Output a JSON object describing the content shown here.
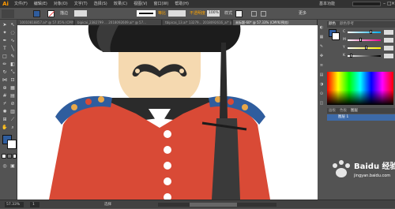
{
  "app": {
    "logo": "Ai"
  },
  "menu": [
    "文件(F)",
    "编辑(E)",
    "对象(O)",
    "文字(T)",
    "选择(S)",
    "效果(C)",
    "视图(V)",
    "窗口(W)",
    "帮助(H)"
  ],
  "workspace": "基本功能",
  "control_bar": {
    "stroke_label": "描边",
    "profile_label": "等比",
    "brush_label": "基本",
    "opacity_label": "不透明度",
    "opacity_value": "100%",
    "style_label": "样式",
    "menu_label": "更多"
  },
  "tabs": [
    {
      "label": "10010818857.ai* @ 57.05% (CMYK/预览)"
    },
    {
      "label": "bipicai_2382799 ... 2018092609.ai* @ 57..."
    },
    {
      "label": "tbipicai_13.ai* 13279... 2018092616_ai* @ ..."
    },
    {
      "label": "未标题-60* @ 57.33% (CMYK/预览)"
    }
  ],
  "right_panel": {
    "color_tab": "颜色",
    "color_guide_tab": "颜色参考",
    "channels": [
      {
        "label": "C",
        "percent": 70
      },
      {
        "label": "M",
        "percent": 40
      },
      {
        "label": "Y",
        "percent": 55
      },
      {
        "label": "K",
        "percent": 10
      }
    ],
    "layers_tab": "图层",
    "artboard_tab": "画板",
    "swatches_tab": "色板",
    "layer_label": "图层 1"
  },
  "status": {
    "zoom": "57.33%",
    "page": "1",
    "tool": "选择"
  },
  "watermark": {
    "text": "Baidu 经验",
    "url": "jingyan.baidu.com"
  },
  "colors": {
    "uniform_red": "#d94a36",
    "skin": "#f5d9b0",
    "dark": "#2b2b2b",
    "gold": "#e8a84a",
    "blue": "#2f5d9e",
    "hat": "#1c1c1c"
  }
}
